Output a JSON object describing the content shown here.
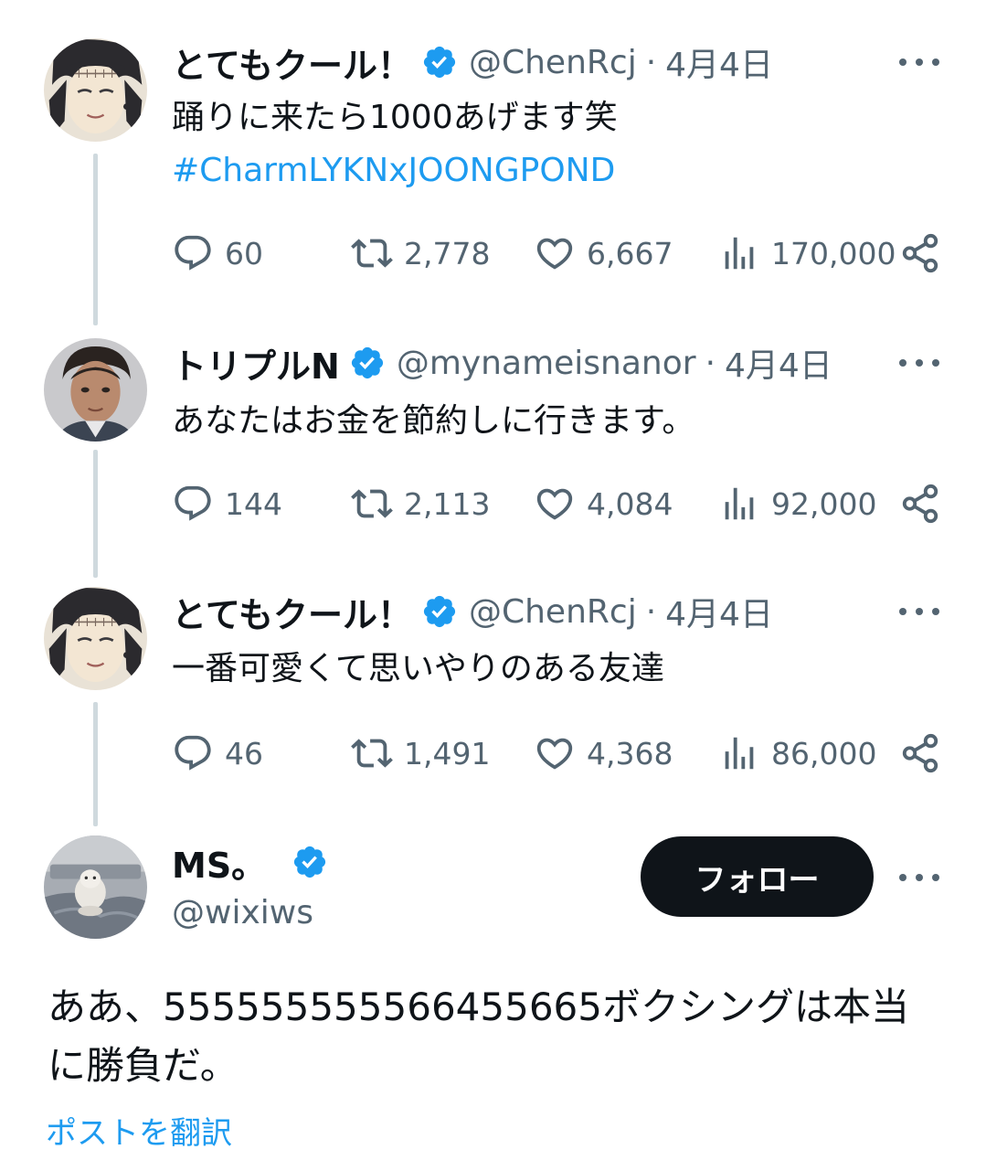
{
  "tweets": [
    {
      "name": "とてもクール！",
      "handle": "@ChenRcj",
      "separator": "·",
      "date": "4月4日",
      "text": "踊りに来たら1000あげます笑",
      "hashtag": "#CharmLYKNxJOONGPOND",
      "replies": "60",
      "retweets": "2,778",
      "likes": "6,667",
      "views": "170,000"
    },
    {
      "name": "トリプルN",
      "handle": "@mynameisnanor",
      "separator": "·",
      "date": "4月4日",
      "text": "あなたはお金を節約しに行きます。",
      "replies": "144",
      "retweets": "2,113",
      "likes": "4,084",
      "views": "92,000"
    },
    {
      "name": "とてもクール！",
      "handle": "@ChenRcj",
      "separator": "·",
      "date": "4月4日",
      "text": "一番可愛くて思いやりのある友達",
      "replies": "46",
      "retweets": "1,491",
      "likes": "4,368",
      "views": "86,000"
    }
  ],
  "main": {
    "name": "MS。",
    "handle": "@wixiws",
    "follow_label": "フォロー",
    "text": "ああ、555555555566455665ボクシングは本当に勝負だ。",
    "translate_label": "ポストを翻訳"
  },
  "icons": {
    "verified": "verified-badge-icon",
    "more": "more-horizontal-icon",
    "reply": "reply-icon",
    "retweet": "retweet-icon",
    "like": "heart-icon",
    "views": "views-icon",
    "share": "share-icon"
  },
  "colors": {
    "accent": "#1d9bf0",
    "text": "#0f1419",
    "secondary": "#536471",
    "thread_line": "#cfd9de"
  }
}
